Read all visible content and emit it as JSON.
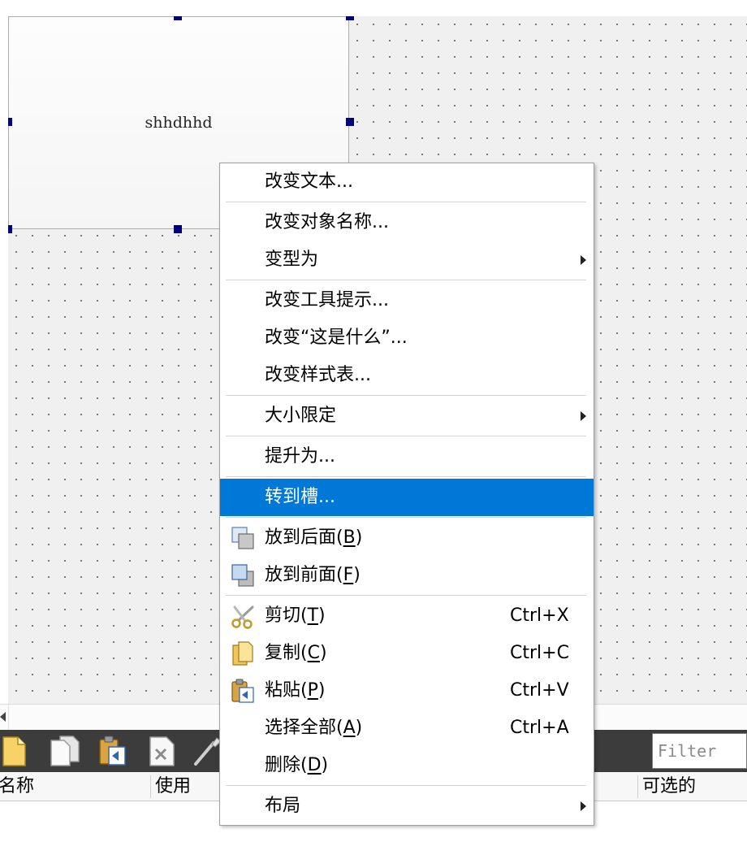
{
  "form": {
    "button_text": "shhdhhd"
  },
  "context_menu": {
    "items": [
      {
        "label": "改变文本..."
      },
      {
        "label": "改变对象名称..."
      },
      {
        "label": "变型为",
        "submenu": true
      },
      {
        "label": "改变工具提示..."
      },
      {
        "label": "改变“这是什么”..."
      },
      {
        "label": "改变样式表..."
      },
      {
        "label": "大小限定",
        "submenu": true
      },
      {
        "label": "提升为..."
      },
      {
        "label": "转到槽...",
        "highlighted": true
      },
      {
        "label": "放到后面(",
        "mnemonic": "B",
        "label_end": ")",
        "icon": "send-to-back-icon"
      },
      {
        "label": "放到前面(",
        "mnemonic": "F",
        "label_end": ")",
        "icon": "bring-to-front-icon"
      },
      {
        "label": "剪切(",
        "mnemonic": "T",
        "label_end": ")",
        "shortcut": "Ctrl+X",
        "icon": "scissors-icon"
      },
      {
        "label": "复制(",
        "mnemonic": "C",
        "label_end": ")",
        "shortcut": "Ctrl+C",
        "icon": "copy-icon"
      },
      {
        "label": "粘贴(",
        "mnemonic": "P",
        "label_end": ")",
        "shortcut": "Ctrl+V",
        "icon": "paste-icon"
      },
      {
        "label": "选择全部(",
        "mnemonic": "A",
        "label_end": ")",
        "shortcut": "Ctrl+A"
      },
      {
        "label": "删除(",
        "mnemonic": "D",
        "label_end": ")"
      },
      {
        "label": "布局",
        "submenu": true
      }
    ]
  },
  "bottom_panel": {
    "toolbar_icons": [
      "new-document-icon",
      "copy-pages-icon",
      "paste-icon",
      "delete-document-icon",
      "tool-icon"
    ],
    "filter_placeholder": "Filter",
    "filter_value": "",
    "columns": [
      {
        "label": "名称"
      },
      {
        "label": "使用"
      },
      {
        "label": "可选的"
      }
    ]
  },
  "colors": {
    "highlight": "#0078d7",
    "highlight_text": "#ffffff",
    "selection_handle": "#000080",
    "toolbar_background": "#3c3c3c",
    "canvas_background": "#f0f0f0"
  }
}
